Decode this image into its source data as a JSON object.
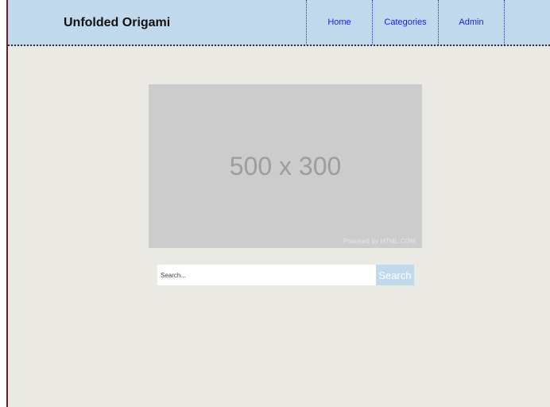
{
  "header": {
    "site_title": "Unfolded Origami",
    "nav": [
      {
        "label": "Home"
      },
      {
        "label": "Categories"
      },
      {
        "label": "Admin"
      }
    ]
  },
  "main": {
    "placeholder_image": {
      "text": "500 x 300",
      "powered_by": "Powered by HTML.COM"
    },
    "search": {
      "placeholder": "Search...",
      "value": "",
      "button_label": "Search"
    }
  },
  "colors": {
    "header_bg": "#c0d9ec",
    "page_bg": "#ebe9e4",
    "nav_link": "#1a1aff",
    "placeholder_bg": "#cccccc",
    "search_button_bg": "#c0d9ec"
  }
}
